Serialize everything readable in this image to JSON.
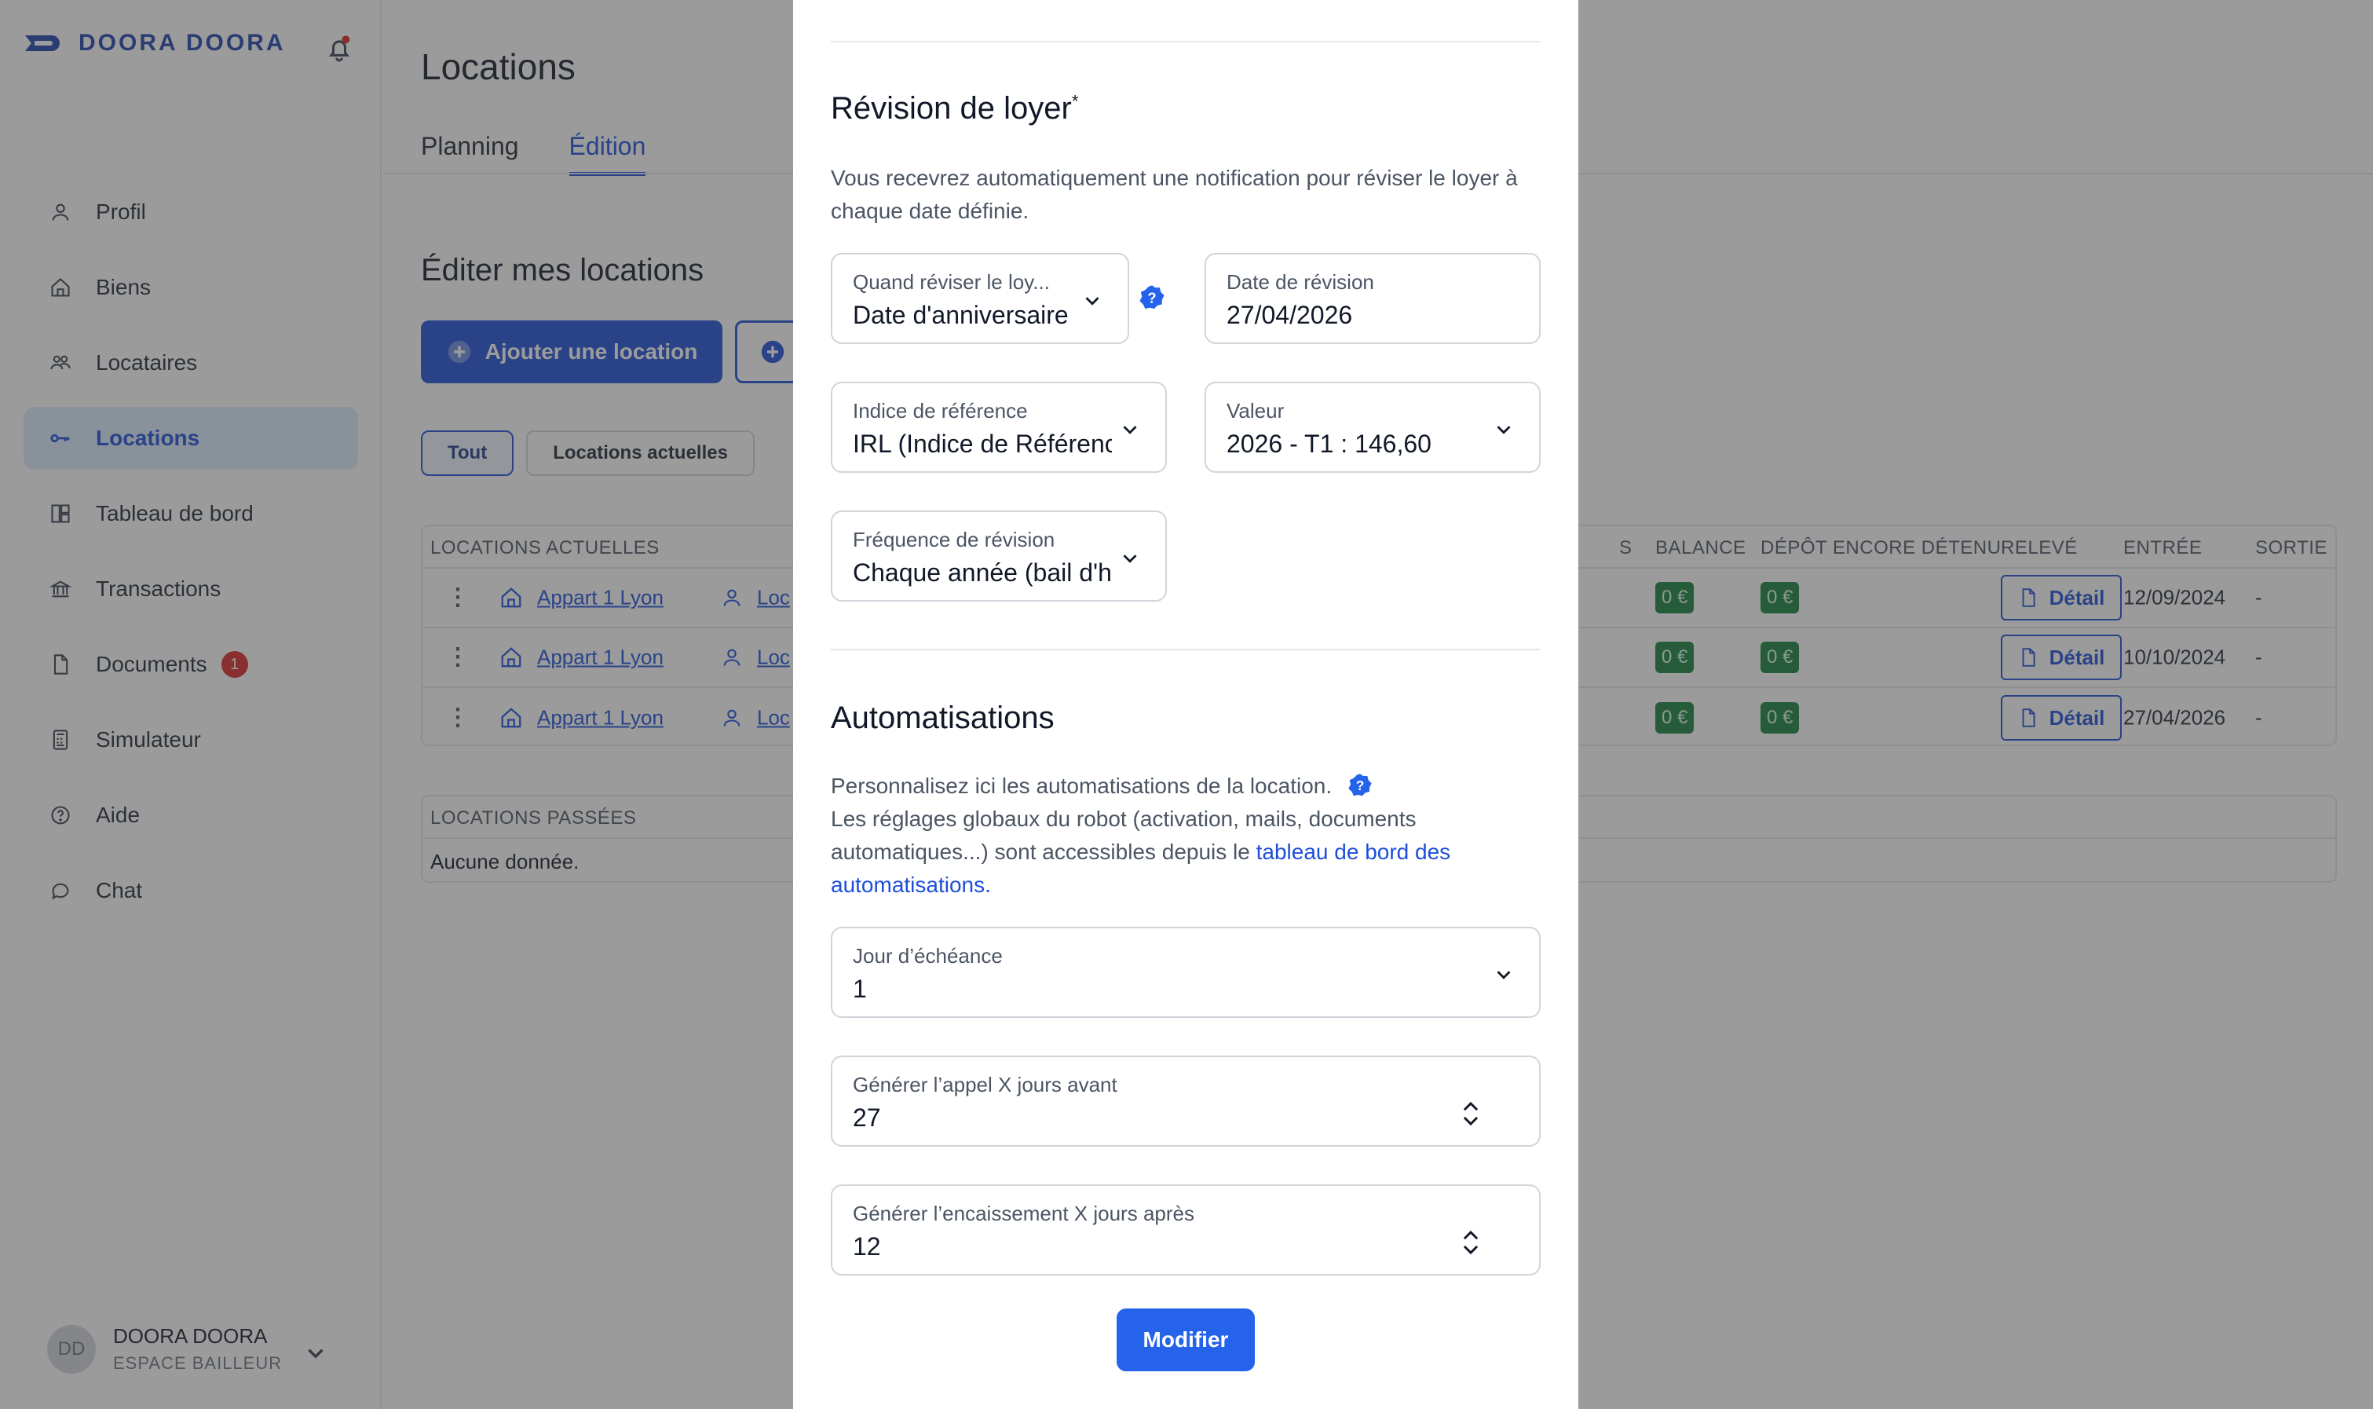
{
  "app": {
    "brand": "DOORA DOORA"
  },
  "sidebar": {
    "items": [
      {
        "label": "Profil",
        "icon": "user-icon"
      },
      {
        "label": "Biens",
        "icon": "home-icon"
      },
      {
        "label": "Locataires",
        "icon": "users-icon"
      },
      {
        "label": "Locations",
        "icon": "key-icon",
        "active": true
      },
      {
        "label": "Tableau de bord",
        "icon": "dashboard-icon"
      },
      {
        "label": "Transactions",
        "icon": "bank-icon"
      },
      {
        "label": "Documents",
        "icon": "document-icon",
        "badge": "1"
      },
      {
        "label": "Simulateur",
        "icon": "calculator-icon"
      },
      {
        "label": "Aide",
        "icon": "help-icon"
      },
      {
        "label": "Chat",
        "icon": "chat-icon"
      }
    ],
    "user": {
      "initials": "DD",
      "name": "DOORA DOORA",
      "role": "ESPACE BAILLEUR"
    }
  },
  "header": {
    "title": "Locations",
    "tabs": [
      {
        "label": "Planning"
      },
      {
        "label": "Édition",
        "active": true
      }
    ]
  },
  "main": {
    "section_title": "Éditer mes locations",
    "add_button": "Ajouter une location",
    "filters": [
      {
        "label": "Tout",
        "active": true
      },
      {
        "label": "Locations actuelles"
      }
    ],
    "current_table": {
      "header": "LOCATIONS ACTUELLES",
      "columns_right": [
        "S",
        "BALANCE",
        "DÉPÔT ENCORE DÉTENU",
        "RELEVÉ",
        "ENTRÉE",
        "SORTIE"
      ],
      "rows": [
        {
          "property": "Appart 1 Lyon",
          "tenant": "Loc",
          "balance": "0 €",
          "deposit": "0 €",
          "statement": "Détail",
          "entry": "12/09/2024",
          "exit": "-"
        },
        {
          "property": "Appart 1 Lyon",
          "tenant": "Loc",
          "balance": "0 €",
          "deposit": "0 €",
          "statement": "Détail",
          "entry": "10/10/2024",
          "exit": "-"
        },
        {
          "property": "Appart 1 Lyon",
          "tenant": "Loc",
          "balance": "0 €",
          "deposit": "0 €",
          "statement": "Détail",
          "entry": "27/04/2026",
          "exit": "-"
        }
      ]
    },
    "past_table": {
      "header": "LOCATIONS PASSÉES",
      "empty": "Aucune donnée."
    }
  },
  "modal": {
    "revision": {
      "title": "Révision de loyer",
      "required_mark": "*",
      "description": "Vous recevrez automatiquement une notification pour réviser le loyer à chaque date définie.",
      "when": {
        "label": "Quand réviser le loy...",
        "value": "Date d'anniversaire"
      },
      "date": {
        "label": "Date de révision",
        "value": "27/04/2026"
      },
      "index": {
        "label": "Indice de référence",
        "value": "IRL (Indice de Référenc"
      },
      "valeur": {
        "label": "Valeur",
        "value": "2026 - T1 : 146,60"
      },
      "frequency": {
        "label": "Fréquence de révision",
        "value": "Chaque année (bail d'h"
      }
    },
    "automations": {
      "title": "Automatisations",
      "description_1": "Personnalisez ici les automatisations de la location.",
      "description_2": "Les réglages globaux du robot (activation, mails, documents automatiques...) sont accessibles depuis le ",
      "link": "tableau de bord des automatisations.",
      "due_day": {
        "label": "Jour d’échéance",
        "value": "1"
      },
      "call_days_before": {
        "label": "Générer l’appel X jours avant",
        "value": "27"
      },
      "collection_days_after": {
        "label": "Générer l’encaissement X jours après",
        "value": "12"
      }
    },
    "submit": "Modifier"
  },
  "colors": {
    "primary": "#1d4ed8",
    "button": "#2563eb",
    "success": "#15803d",
    "badge": "#dc2626"
  }
}
